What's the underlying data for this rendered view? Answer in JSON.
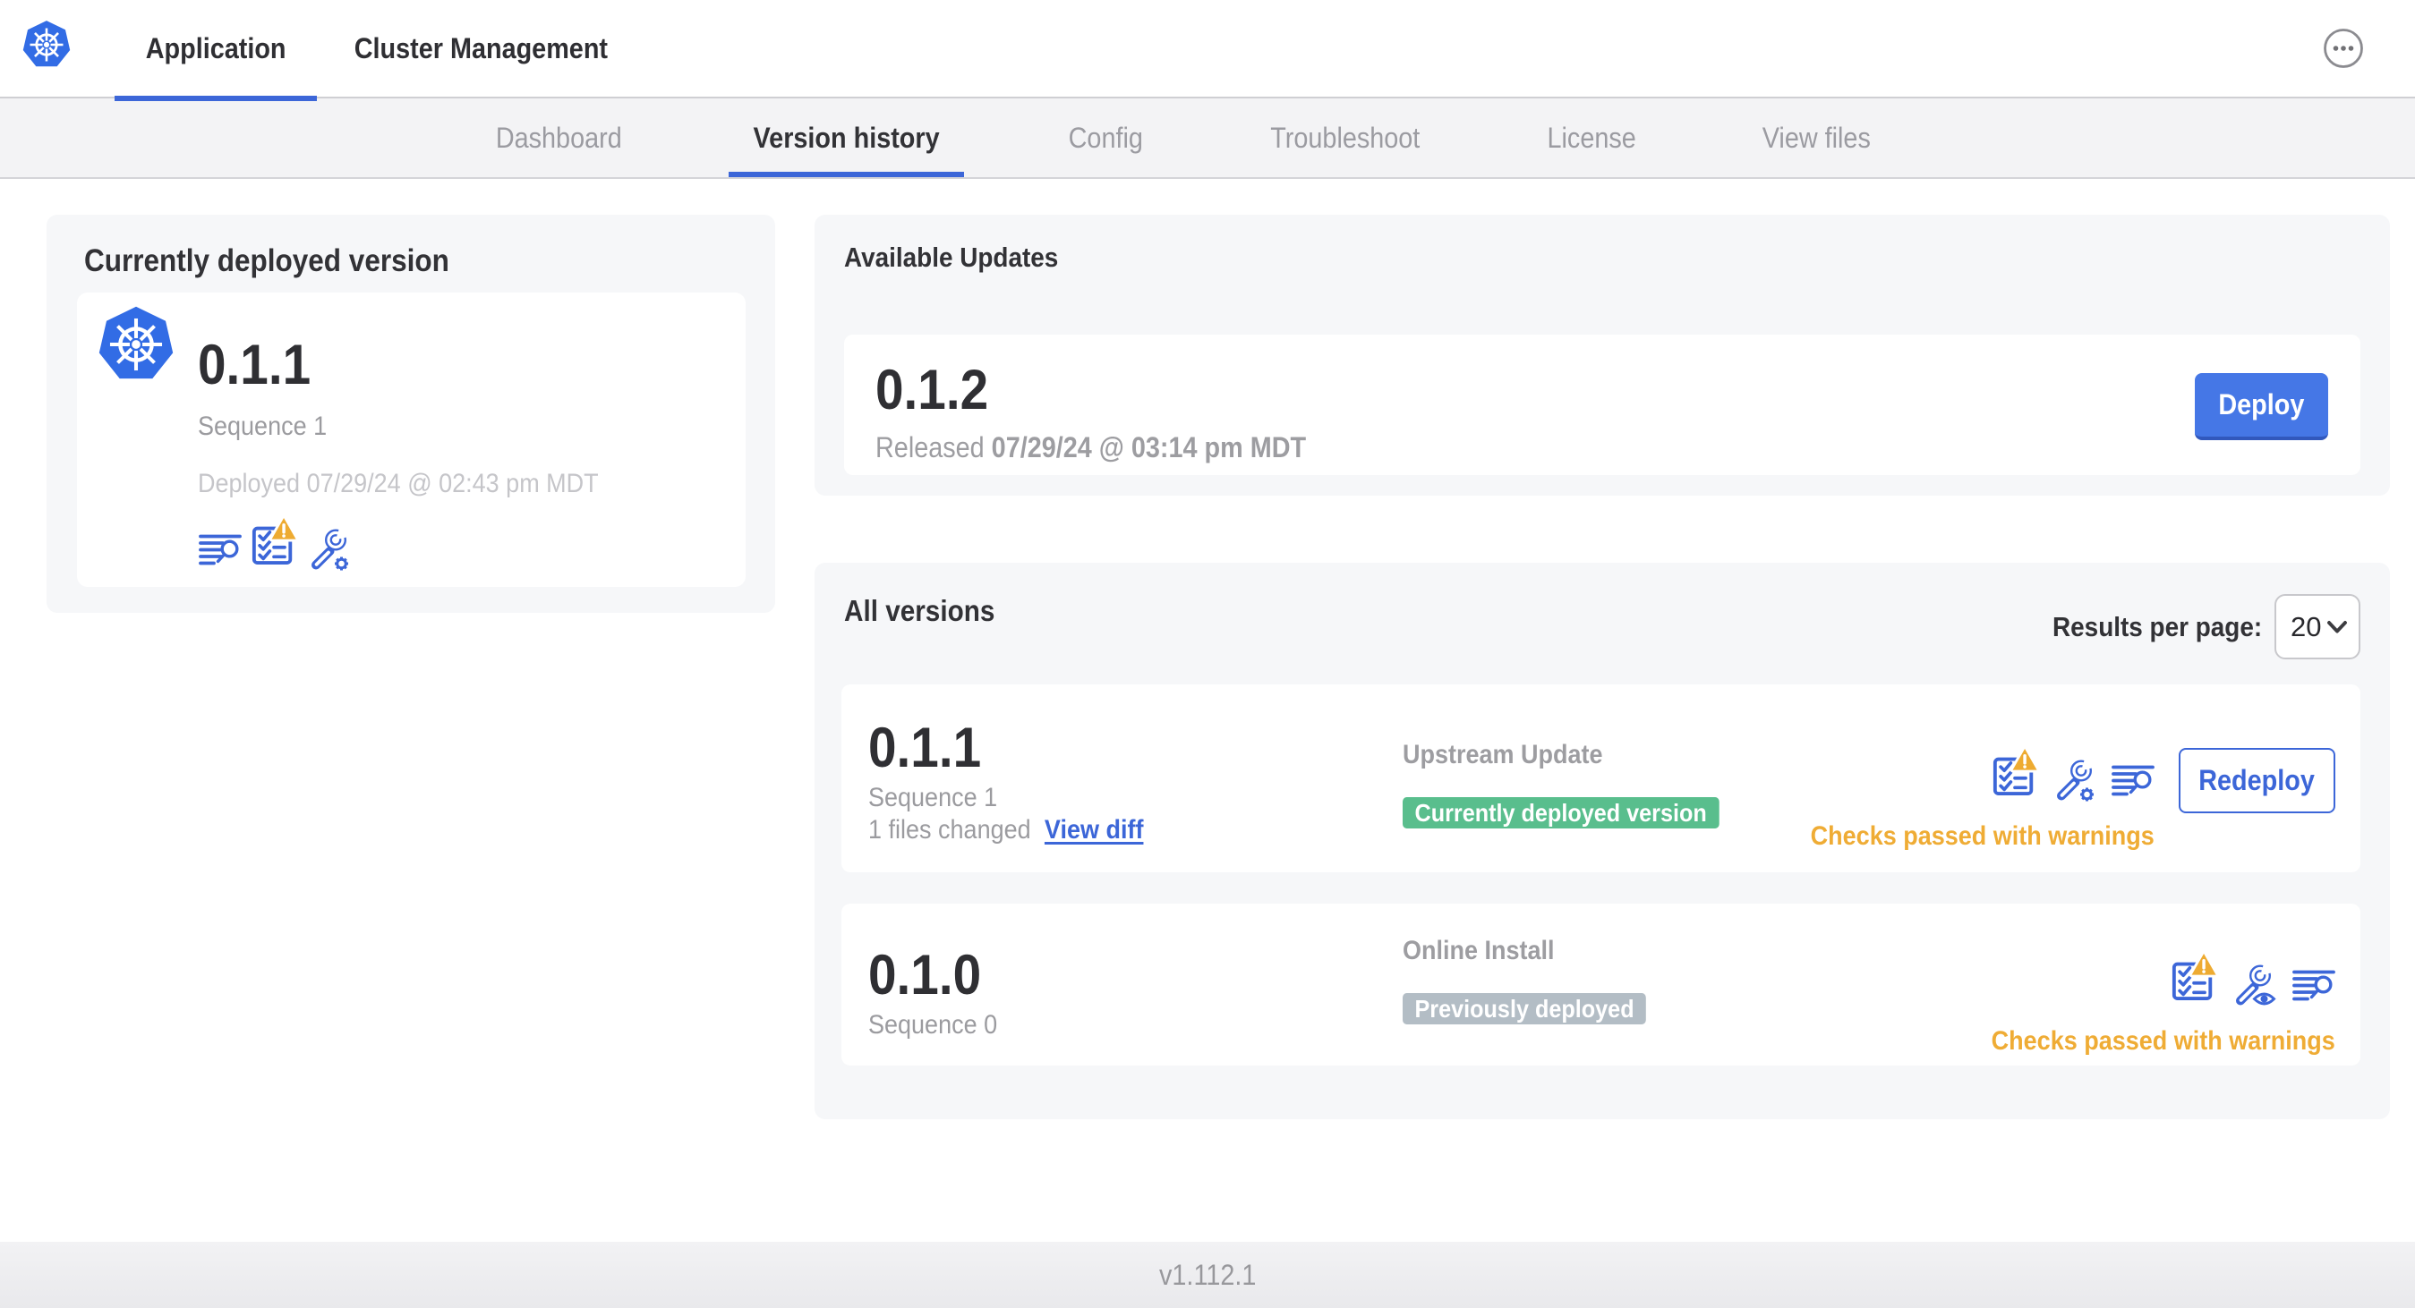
{
  "header": {
    "logo": "kubernetes-logo",
    "tabs": [
      {
        "label": "Application",
        "active": true
      },
      {
        "label": "Cluster Management",
        "active": false
      }
    ],
    "menu": "ellipsis-menu"
  },
  "subnav": {
    "tabs": [
      {
        "label": "Dashboard",
        "active": false
      },
      {
        "label": "Version history",
        "active": true
      },
      {
        "label": "Config",
        "active": false
      },
      {
        "label": "Troubleshoot",
        "active": false
      },
      {
        "label": "License",
        "active": false
      },
      {
        "label": "View files",
        "active": false
      }
    ]
  },
  "deployed": {
    "title": "Currently deployed version",
    "version": "0.1.1",
    "sequence": "Sequence 1",
    "deployed_label": "Deployed",
    "deployed_at": "07/29/24 @ 02:43 pm MDT"
  },
  "available": {
    "title": "Available Updates",
    "version": "0.1.2",
    "released_label": "Released",
    "released_at": "07/29/24 @ 03:14 pm MDT",
    "deploy_button": "Deploy"
  },
  "all_versions": {
    "title": "All versions",
    "results_per_page_label": "Results per page:",
    "results_per_page_value": "20",
    "rows": [
      {
        "version": "0.1.1",
        "sequence": "Sequence 1",
        "files_changed": "1 files changed",
        "view_diff_link": "View diff",
        "source_type": "Upstream Update",
        "status_badge": "Currently deployed version",
        "checks_status": "Checks passed with warnings",
        "action_button": "Redeploy"
      },
      {
        "version": "0.1.0",
        "sequence": "Sequence 0",
        "source_type": "Online Install",
        "status_badge": "Previously deployed",
        "checks_status": "Checks passed with warnings"
      }
    ]
  },
  "footer": {
    "app_version": "v1.112.1"
  },
  "colors": {
    "accent_blue": "#3c66d8",
    "button_blue": "#4577e6",
    "success_green": "#59be8d",
    "muted_badge_gray": "#b3bdc5",
    "warning_amber": "#efac35",
    "kubernetes_blue": "#326ce5"
  }
}
